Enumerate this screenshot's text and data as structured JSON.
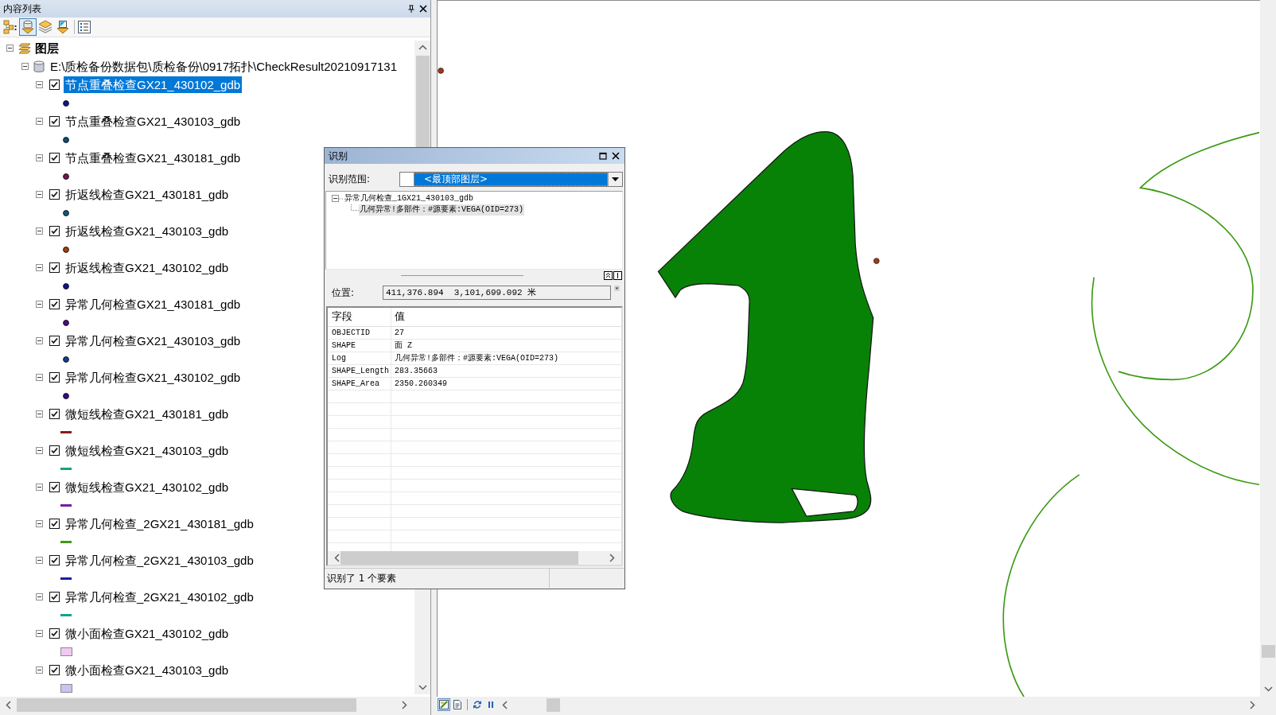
{
  "contents": {
    "title": "内容列表",
    "toolbar": [
      {
        "kind": "drawing-order",
        "selected": false
      },
      {
        "kind": "source",
        "selected": true
      },
      {
        "kind": "visibility",
        "selected": false
      },
      {
        "kind": "selection",
        "selected": false
      },
      {
        "kind": "options",
        "selected": false
      }
    ],
    "tree": {
      "kind": "frame",
      "label": "图层",
      "expanded": true,
      "children": [
        {
          "kind": "workspace",
          "label": "E:\\质检备份数据包\\质检备份\\0917拓扑\\CheckResult20210917131",
          "expanded": true,
          "children": [
            {
              "label": "节点重叠检查GX21_430102_gdb",
              "checked": true,
              "expanded": true,
              "selected": true,
              "kind": "point",
              "color": "#14148c"
            },
            {
              "label": "节点重叠检查GX21_430103_gdb",
              "checked": true,
              "expanded": true,
              "selected": false,
              "kind": "point",
              "color": "#0d4f7c"
            },
            {
              "label": "节点重叠检查GX21_430181_gdb",
              "checked": true,
              "expanded": true,
              "selected": false,
              "kind": "point",
              "color": "#7a1452"
            },
            {
              "label": "折返线检查GX21_430181_gdb",
              "checked": true,
              "expanded": true,
              "selected": false,
              "kind": "point",
              "color": "#0f5a80"
            },
            {
              "label": "折返线检查GX21_430103_gdb",
              "checked": true,
              "expanded": true,
              "selected": false,
              "kind": "point",
              "color": "#a8400f"
            },
            {
              "label": "折返线检查GX21_430102_gdb",
              "checked": true,
              "expanded": true,
              "selected": false,
              "kind": "point",
              "color": "#141490"
            },
            {
              "label": "异常几何检查GX21_430181_gdb",
              "checked": true,
              "expanded": true,
              "selected": false,
              "kind": "point",
              "color": "#4c0c88"
            },
            {
              "label": "异常几何检查GX21_430103_gdb",
              "checked": true,
              "expanded": true,
              "selected": false,
              "kind": "point",
              "color": "#0f3f96"
            },
            {
              "label": "异常几何检查GX21_430102_gdb",
              "checked": true,
              "expanded": true,
              "selected": false,
              "kind": "point",
              "color": "#3a0c8a"
            },
            {
              "label": "微短线检查GX21_430181_gdb",
              "checked": true,
              "expanded": true,
              "selected": false,
              "kind": "line",
              "color": "#8b1a1a"
            },
            {
              "label": "微短线检查GX21_430103_gdb",
              "checked": true,
              "expanded": true,
              "selected": false,
              "kind": "line",
              "color": "#12a37f"
            },
            {
              "label": "微短线检查GX21_430102_gdb",
              "checked": true,
              "expanded": true,
              "selected": false,
              "kind": "line",
              "color": "#7a1aa0"
            },
            {
              "label": "异常几何检查_2GX21_430181_gdb",
              "checked": true,
              "expanded": true,
              "selected": false,
              "kind": "line",
              "color": "#3f9b12"
            },
            {
              "label": "异常几何检查_2GX21_430103_gdb",
              "checked": true,
              "expanded": true,
              "selected": false,
              "kind": "line",
              "color": "#1c1ca8"
            },
            {
              "label": "异常几何检查_2GX21_430102_gdb",
              "checked": true,
              "expanded": true,
              "selected": false,
              "kind": "line",
              "color": "#14a38f"
            },
            {
              "label": "微小面检查GX21_430102_gdb",
              "checked": true,
              "expanded": true,
              "selected": false,
              "kind": "fill",
              "color": "#f2c9f2"
            },
            {
              "label": "微小面检查GX21_430103_gdb",
              "checked": true,
              "expanded": true,
              "selected": false,
              "kind": "fill",
              "color": "#cbc2f2"
            }
          ]
        }
      ]
    }
  },
  "map": {
    "view_buttons": [
      {
        "kind": "data",
        "selected": true
      },
      {
        "kind": "layout",
        "selected": false
      }
    ],
    "tools": [
      {
        "kind": "refresh"
      },
      {
        "kind": "pause"
      }
    ]
  },
  "identify": {
    "title": "识别",
    "scope_label": "识别范围:",
    "scope_value": "<最顶部图层>",
    "results": [
      {
        "label": "异常几何检查_1GX21_430103_gdb",
        "expanded": true,
        "selected": false,
        "children": [
          {
            "label": "几何异常!多部件：#源要素:VEGA(OID=273)",
            "selected": true
          }
        ]
      }
    ],
    "location_label": "位置:",
    "location_value": "411,376.894  3,101,699.092 米",
    "columns": [
      "字段",
      "值"
    ],
    "rows": [
      [
        "OBJECTID",
        "27"
      ],
      [
        "SHAPE",
        "面 Z"
      ],
      [
        "Log",
        "几何异常!多部件：#源要素:VEGA(OID=273)"
      ],
      [
        "SHAPE_Length",
        "283.35663"
      ],
      [
        "SHAPE_Area",
        "2350.260349"
      ]
    ],
    "status": "识别了 1 个要素"
  }
}
